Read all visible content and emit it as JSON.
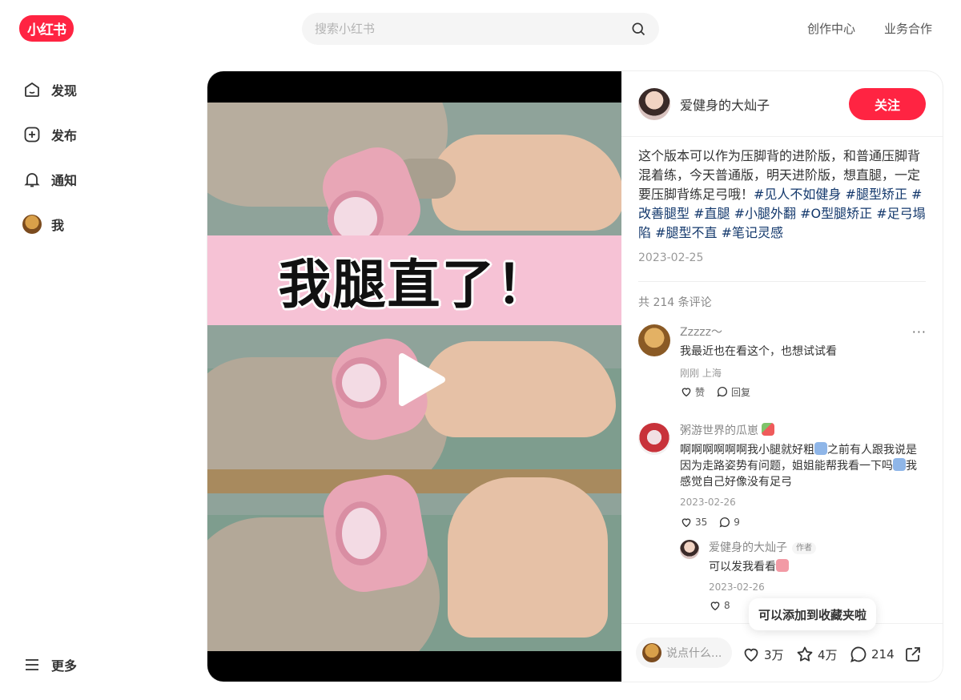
{
  "header": {
    "logo_text": "小红书",
    "search_placeholder": "搜索小红书",
    "links": [
      "创作中心",
      "业务合作"
    ]
  },
  "sidebar": {
    "items": [
      {
        "label": "发现",
        "icon": "home-icon"
      },
      {
        "label": "发布",
        "icon": "plus-square-icon"
      },
      {
        "label": "通知",
        "icon": "bell-icon"
      },
      {
        "label": "我",
        "icon": "avatar"
      }
    ],
    "more_label": "更多"
  },
  "media": {
    "banner_text": "我腿直了！"
  },
  "note": {
    "author": "爱健身的大灿子",
    "follow_label": "关注",
    "desc_text": "这个版本可以作为压脚背的进阶版，和普通压脚背混着练，今天普通版，明天进阶版，想直腿，一定要压脚背练足弓哦！",
    "tags": [
      "#见人不如健身",
      "#腿型矫正",
      "#改善腿型",
      "#直腿",
      "#小腿外翻",
      "#O型腿矫正",
      "#足弓塌陷",
      "#腿型不直",
      "#笔记灵感"
    ],
    "date": "2023-02-25",
    "comment_total": "共 214 条评论"
  },
  "comments": [
    {
      "name": "Zzzzz～",
      "text": "我最近也在看这个，也想试试看",
      "meta": "刚刚 上海",
      "like_label": "赞",
      "reply_label": "回复"
    },
    {
      "name": "粥游世界的瓜崽",
      "text_a": "啊啊啊啊啊啊我小腿就好粗",
      "text_b": "之前有人跟我说是因为走路姿势有问题，姐姐能帮我看一下吗",
      "text_c": "我感觉自己好像没有足弓",
      "meta": "2023-02-26",
      "likes": "35",
      "replies": "9"
    }
  ],
  "reply": {
    "name": "爱健身的大灿子",
    "author_tag": "作者",
    "text": "可以发我看看",
    "meta": "2023-02-26",
    "likes": "8"
  },
  "tooltip": "可以添加到收藏夹啦",
  "bottom": {
    "input_placeholder": "说点什么...",
    "likes": "3万",
    "collects": "4万",
    "comments": "214"
  },
  "colors": {
    "brand": "#ff2442",
    "tag": "#13386c"
  }
}
